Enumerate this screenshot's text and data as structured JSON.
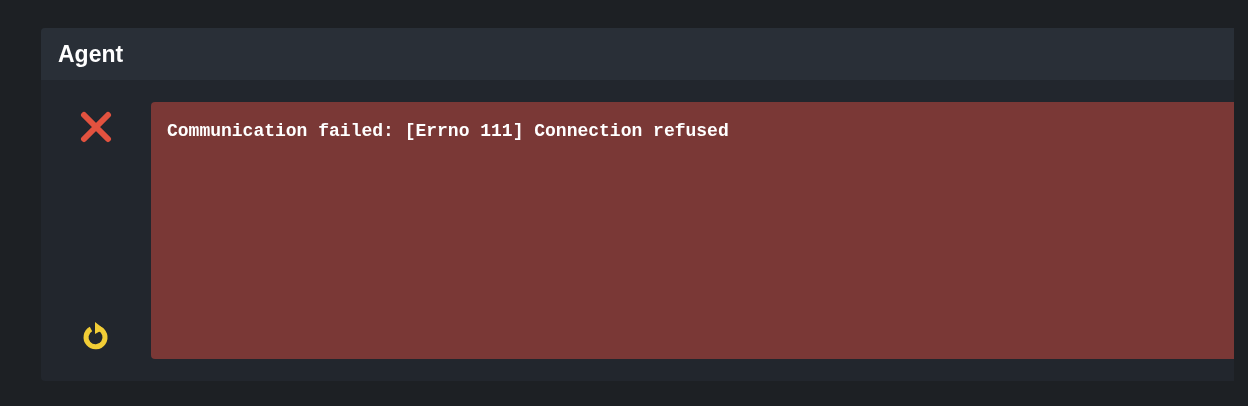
{
  "panel": {
    "title": "Agent"
  },
  "result": {
    "kind": "error",
    "message": "Communication failed: [Errno 111] Connection refused"
  }
}
